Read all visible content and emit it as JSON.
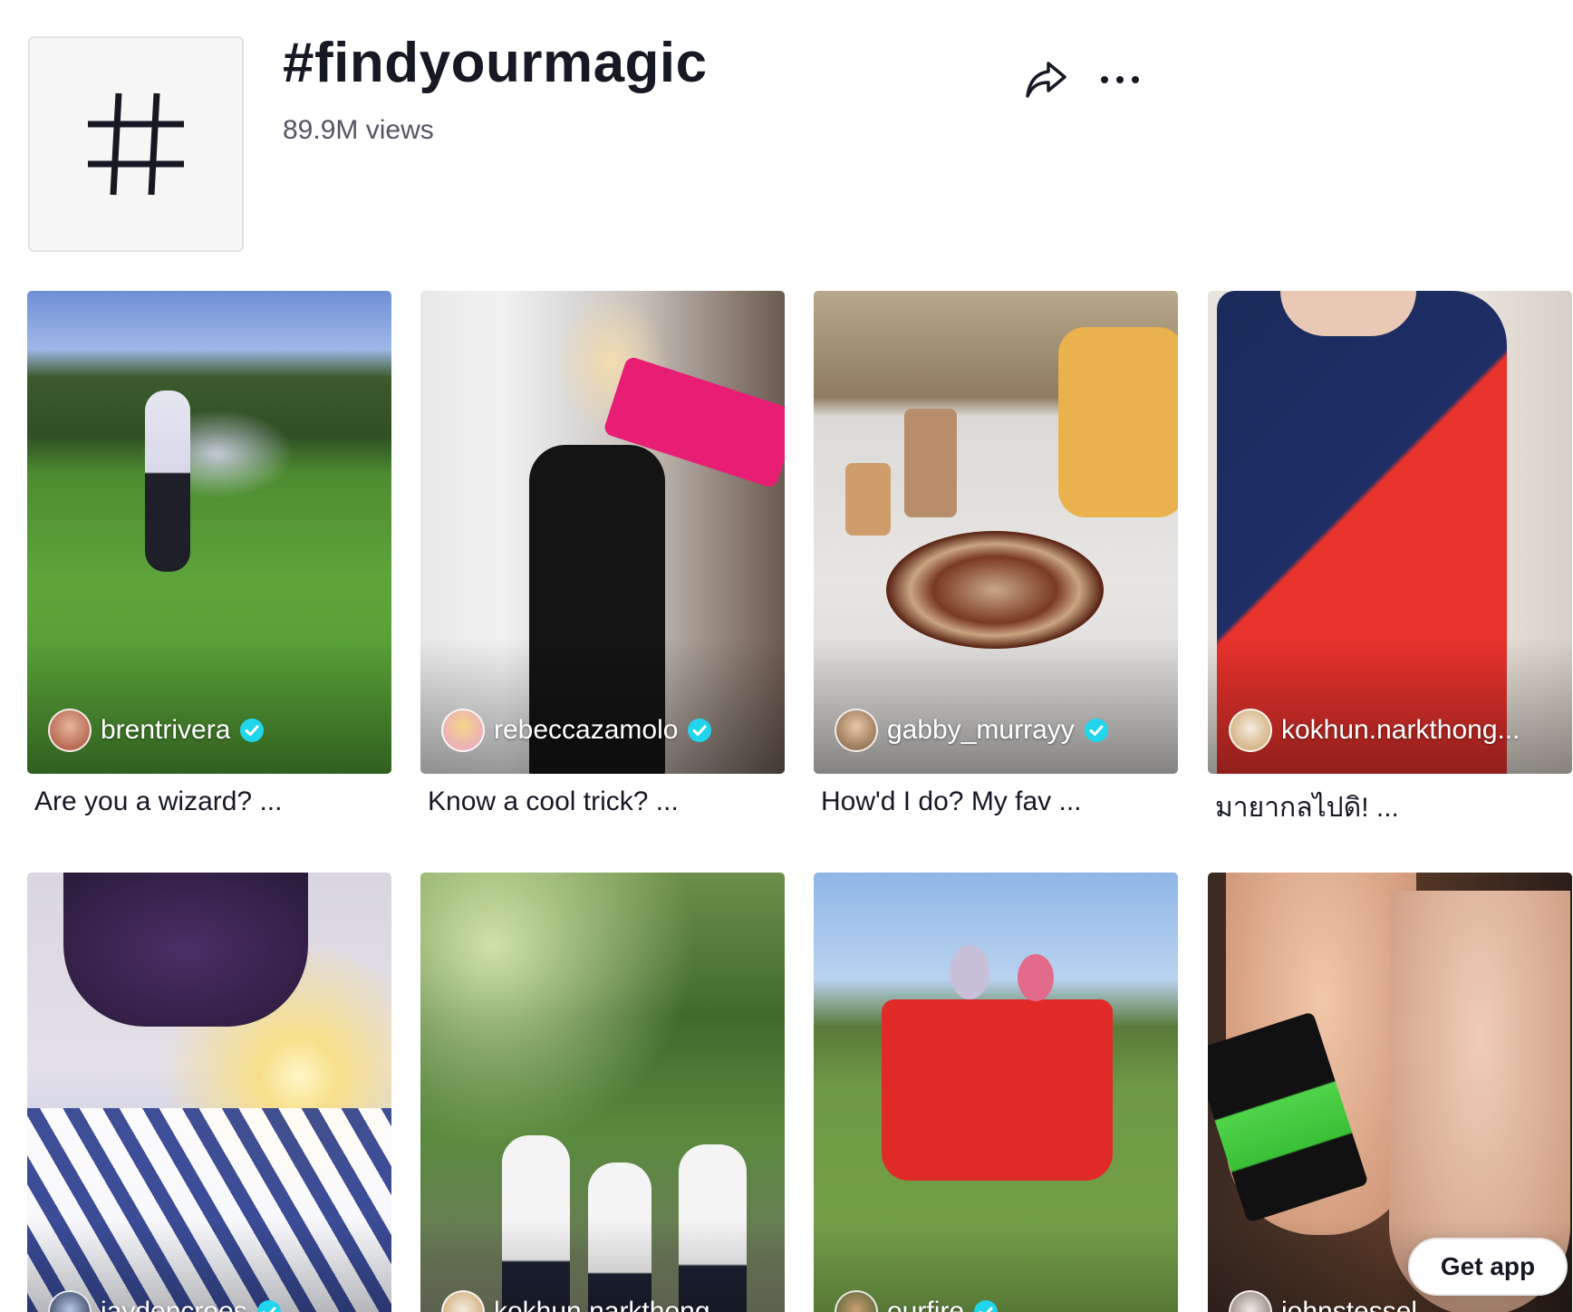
{
  "header": {
    "title": "#findyourmagic",
    "views": "89.9M views",
    "cover_icon": "hashtag-icon",
    "share_icon": "share-arrow-icon",
    "more_icon": "more-horizontal-icon"
  },
  "videos": [
    {
      "username": "brentrivera",
      "verified": true,
      "caption": "Are you a wizard? ..."
    },
    {
      "username": "rebeccazamolo",
      "verified": true,
      "caption": "Know a cool trick? ..."
    },
    {
      "username": "gabby_murrayy",
      "verified": true,
      "caption": "How'd I do? My fav ..."
    },
    {
      "username": "kokhun.narkthong...",
      "verified": false,
      "caption": "มายากลไปดิ! ..."
    },
    {
      "username": "jaydencroes",
      "verified": true,
      "caption": ""
    },
    {
      "username": "kokhun.narkthong",
      "verified": false,
      "caption": ""
    },
    {
      "username": "ourfire",
      "verified": true,
      "caption": ""
    },
    {
      "username": "johnstessel",
      "verified": false,
      "caption": ""
    }
  ],
  "get_app_label": "Get app",
  "colors": {
    "verified_badge": "#20d5ec",
    "text_primary": "#161823",
    "text_secondary": "#555662"
  }
}
